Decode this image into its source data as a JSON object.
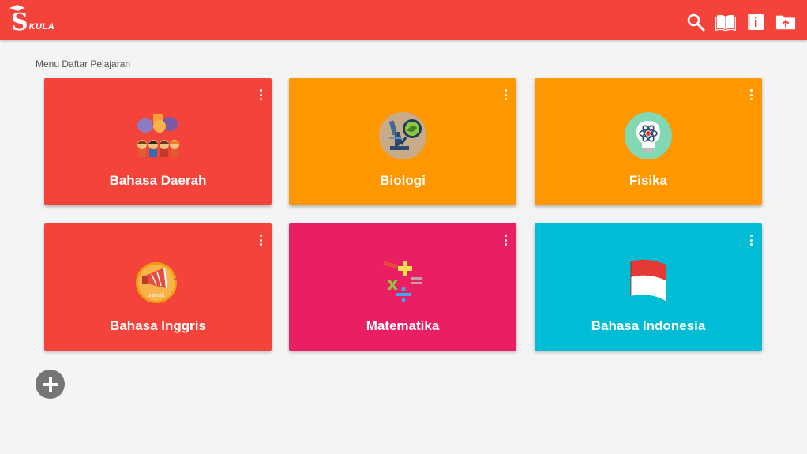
{
  "app": {
    "logo_text": "KULA",
    "bar_color": "#f4433a"
  },
  "toolbar": {
    "icons": [
      "search-icon",
      "book-icon",
      "info-book-icon",
      "folder-upload-icon"
    ]
  },
  "main": {
    "section_title": "Menu Daftar Pelajaran",
    "subjects": [
      {
        "label": "Bahasa Daerah",
        "color": "#f4433a",
        "icon": "people-speech-icon"
      },
      {
        "label": "Biologi",
        "color": "#ff9800",
        "icon": "microscope-icon"
      },
      {
        "label": "Fisika",
        "color": "#ff9800",
        "icon": "atom-bulb-icon"
      },
      {
        "label": "Bahasa Inggris",
        "color": "#f4433a",
        "icon": "megaphone-speak-icon"
      },
      {
        "label": "Matematika",
        "color": "#e91e63",
        "icon": "math-symbols-icon"
      },
      {
        "label": "Bahasa Indonesia",
        "color": "#00bcd4",
        "icon": "indonesia-flag-icon"
      }
    ]
  },
  "fab": {
    "icon": "add-icon"
  }
}
